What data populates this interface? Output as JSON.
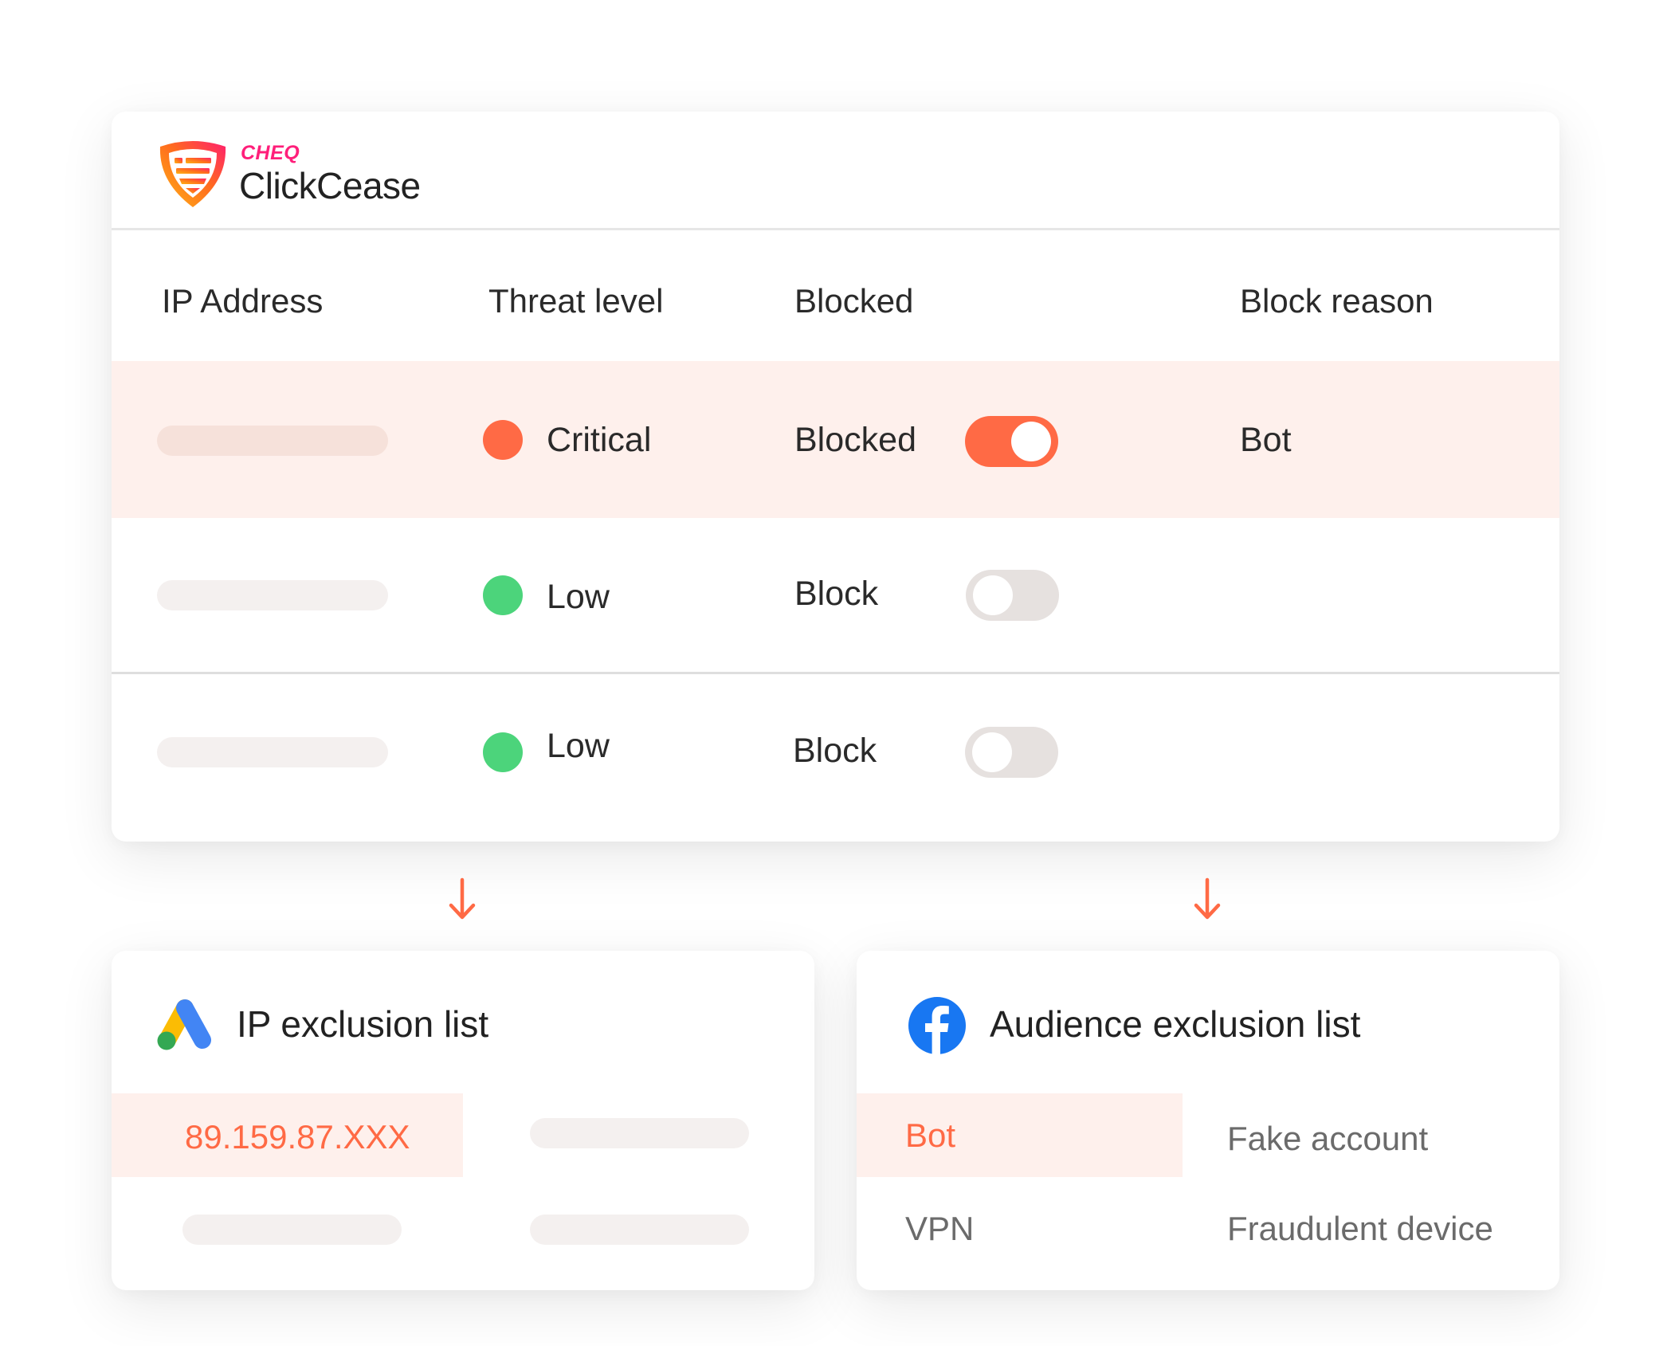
{
  "brand": {
    "parent": "CHEQ",
    "name": "ClickCease"
  },
  "table": {
    "headers": [
      "IP Address",
      "Threat level",
      "Blocked",
      "Block reason"
    ],
    "rows": [
      {
        "ip": "",
        "threat": "Critical",
        "threat_color": "#ff6a45",
        "blocked_label": "Blocked",
        "blocked": true,
        "reason": "Bot",
        "highlighted": true
      },
      {
        "ip": "",
        "threat": "Low",
        "threat_color": "#4cd47b",
        "blocked_label": "Block",
        "blocked": false,
        "reason": "",
        "highlighted": false
      },
      {
        "ip": "",
        "threat": "Low",
        "threat_color": "#4cd47b",
        "blocked_label": "Block",
        "blocked": false,
        "reason": "",
        "highlighted": false
      }
    ]
  },
  "ip_exclusion": {
    "title": "IP exclusion list",
    "icon": "google-ads-icon",
    "items": [
      "89.159.87.XXX"
    ]
  },
  "audience_exclusion": {
    "title": "Audience exclusion list",
    "icon": "facebook-icon",
    "items": [
      "Bot",
      "Fake account",
      "VPN",
      "Fraudulent device"
    ]
  },
  "colors": {
    "accent": "#ff6a45",
    "highlight_bg": "#fef0ec",
    "low": "#4cd47b",
    "cheq_pink": "#ff1f7a"
  }
}
